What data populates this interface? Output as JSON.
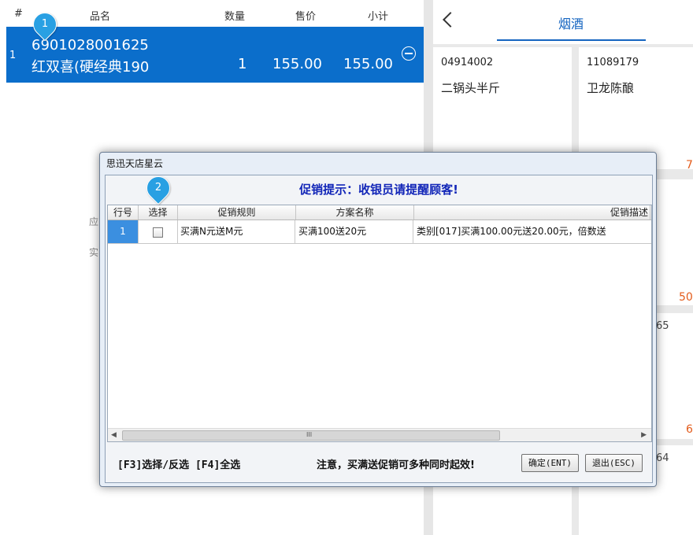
{
  "cart": {
    "headers": {
      "index": "#",
      "name": "品名",
      "qty": "数量",
      "price": "售价",
      "subtotal": "小计"
    },
    "row": {
      "index": "1",
      "code": "6901028001625",
      "name": "红双喜(硬经典190",
      "qty": "1",
      "price": "155.00",
      "subtotal": "155.00"
    },
    "side_labels": [
      "应",
      "实"
    ]
  },
  "right_panel": {
    "tab_label": "烟酒",
    "products": [
      {
        "code": "04914002",
        "name": "二锅头半斤"
      },
      {
        "code": "11089179",
        "name": "卫龙陈酿"
      }
    ],
    "partial_prices": [
      "7",
      "50",
      "6"
    ],
    "partial_codes": [
      "65",
      "64"
    ]
  },
  "markers": [
    "1",
    "2"
  ],
  "dialog": {
    "title": "思迅天店星云",
    "hint": "促销提示：收银员请提醒顾客!",
    "columns": [
      "行号",
      "选择",
      "促销规则",
      "方案名称",
      "促销描述"
    ],
    "rows": [
      {
        "row_no": "1",
        "checked": false,
        "rule": "买满N元送M元",
        "plan": "买满100送20元",
        "desc": "类别[017]买满100.00元送20.00元，倍数送"
      }
    ],
    "scroll_grip": "III",
    "shortcut_text": "[F3]选择/反选 [F4]全选",
    "notice_text": "注意，买满送促销可多种同时起效!",
    "ok_label": "确定(ENT)",
    "exit_label": "退出(ESC)"
  }
}
